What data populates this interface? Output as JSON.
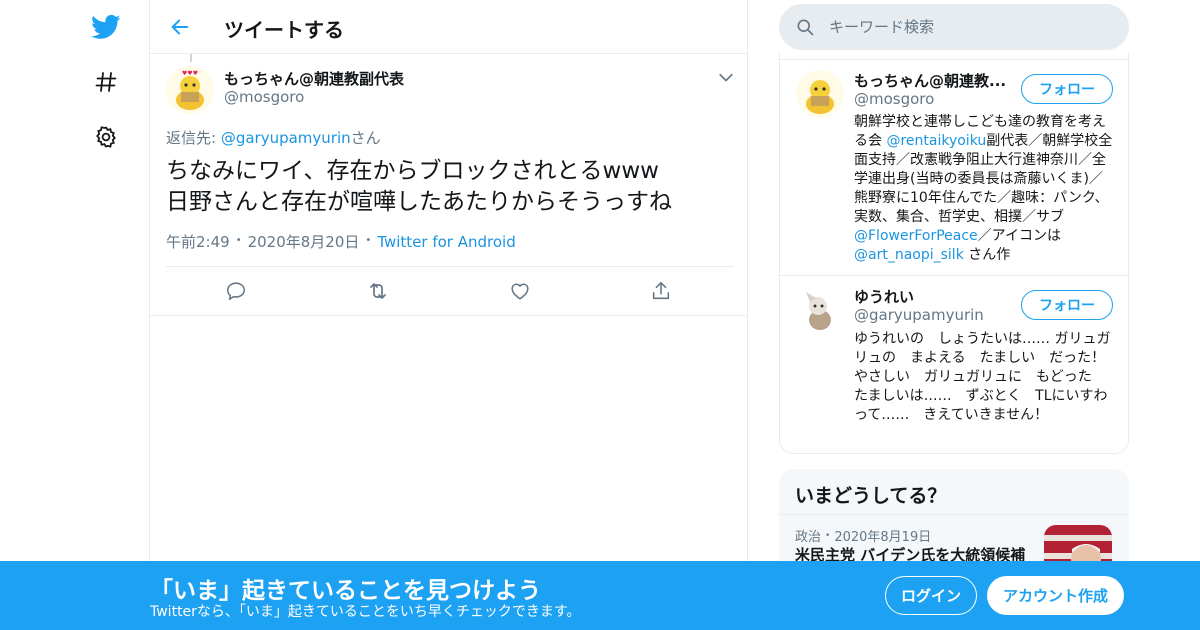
{
  "header": {
    "title": "ツイートする"
  },
  "tweet": {
    "author_name": "もっちゃん@朝連教副代表",
    "author_handle": "@mosgoro",
    "reply_prefix": "返信先: ",
    "reply_handle": "@garyupamyurin",
    "reply_suffix": "さん",
    "text_line1": "ちなみにワイ、存在からブロックされとるwww",
    "text_line2": "日野さんと存在が喧嘩したあたりからそうっすね",
    "time": "午前2:49",
    "date": "2020年8月20日",
    "source": "Twitter for Android"
  },
  "search": {
    "placeholder": "キーワード検索"
  },
  "users": [
    {
      "name": "もっちゃん@朝連教...",
      "handle": "@mosgoro",
      "follow_label": "フォロー",
      "bio_parts": [
        "朝鮮学校と連帯しこども達の教育を考える会 ",
        "@rentaikyoiku",
        "副代表／朝鮮学校全面支持／改憲戦争阻止大行進神奈川／全学連出身(当時の委員長は斎藤いくま)／熊野寮に10年住んでた／趣味：パンク、実数、集合、哲学史、相撲／サブ",
        "@FlowerForPeace",
        "／アイコンは ",
        "@art_naopi_silk",
        " さん作"
      ]
    },
    {
      "name": "ゆうれい",
      "handle": "@garyupamyurin",
      "follow_label": "フォロー",
      "bio": "ゆうれいの　しょうたいは…… ガリュガリュの　まよえる　たましい　だった！ やさしい　ガリュガリュに　もどった　たましいは……　ずぶとく　TLにいすわって……　きえていきません！"
    }
  ],
  "trends": {
    "title": "いまどうしてる？",
    "category": "政治",
    "date": "2020年8月19日",
    "headline": "米民主党 バイデン氏を大統領候補"
  },
  "banner": {
    "title": "「いま」起きていることを見つけよう",
    "subtitle": "Twitterなら、「いま」起きていることをいち早くチェックできます。",
    "login_label": "ログイン",
    "signup_label": "アカウント作成"
  },
  "colors": {
    "brand": "#1da1f2",
    "link": "#1b95e0",
    "muted": "#657786",
    "border": "#e6ecf0"
  },
  "icons": [
    "twitter-bird-icon",
    "hashtag-icon",
    "gear-icon",
    "back-arrow-icon",
    "chevron-down-icon",
    "reply-icon",
    "retweet-icon",
    "like-icon",
    "share-icon",
    "search-icon"
  ]
}
